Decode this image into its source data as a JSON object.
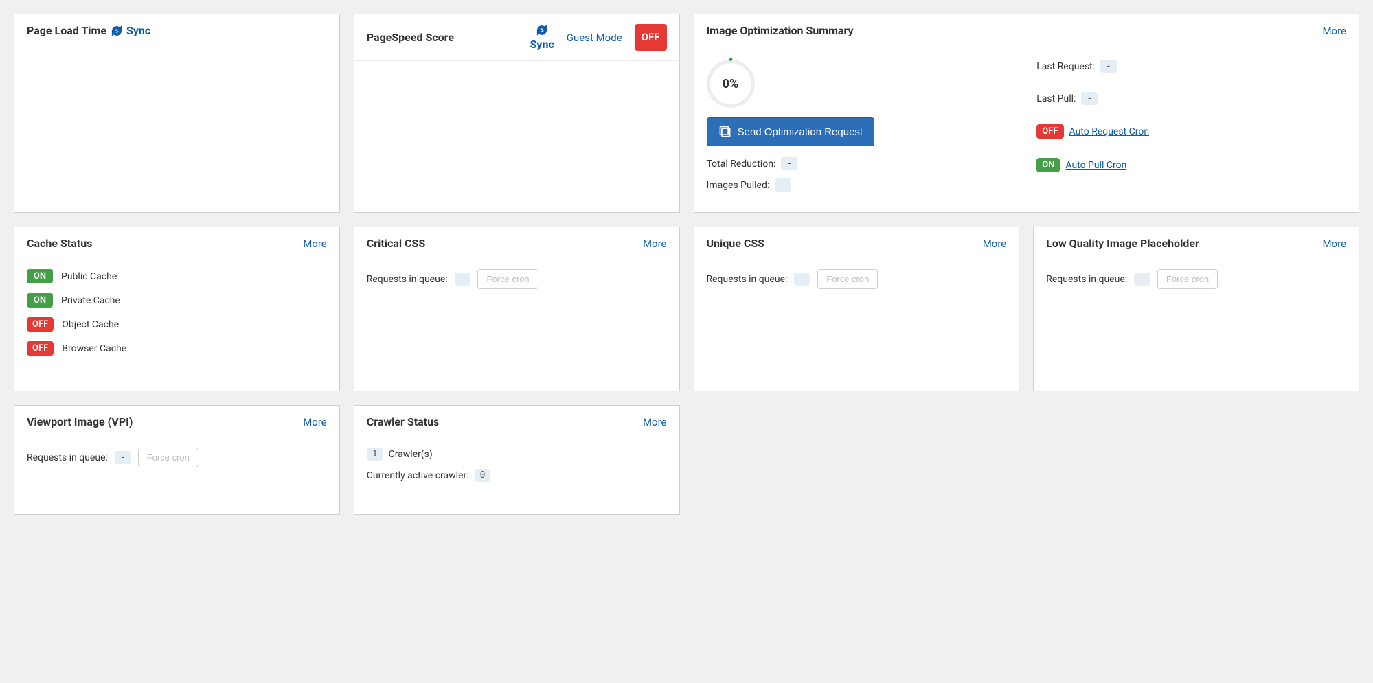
{
  "labels": {
    "sync": "Sync",
    "more": "More",
    "guest_mode": "Guest Mode",
    "force_cron": "Force cron",
    "requests_in_queue": "Requests in queue:",
    "on": "ON",
    "off": "OFF"
  },
  "page_load": {
    "title": "Page Load Time"
  },
  "pagespeed": {
    "title": "PageSpeed Score",
    "badge": "OFF"
  },
  "image_opt": {
    "title": "Image Optimization Summary",
    "gauge": "0%",
    "send_button": "Send Optimization Request",
    "total_reduction_label": "Total Reduction:",
    "total_reduction_value": "-",
    "images_pulled_label": "Images Pulled:",
    "images_pulled_value": "-",
    "last_request_label": "Last Request:",
    "last_request_value": "-",
    "last_pull_label": "Last Pull:",
    "last_pull_value": "-",
    "auto_request_cron": "Auto Request Cron",
    "auto_request_cron_state": "OFF",
    "auto_pull_cron": "Auto Pull Cron",
    "auto_pull_cron_state": "ON"
  },
  "cache_status": {
    "title": "Cache Status",
    "items": [
      {
        "state": "ON",
        "label": "Public Cache"
      },
      {
        "state": "ON",
        "label": "Private Cache"
      },
      {
        "state": "OFF",
        "label": "Object Cache"
      },
      {
        "state": "OFF",
        "label": "Browser Cache"
      }
    ]
  },
  "critical_css": {
    "title": "Critical CSS",
    "queue_value": "-"
  },
  "unique_css": {
    "title": "Unique CSS",
    "queue_value": "-"
  },
  "lqip": {
    "title": "Low Quality Image Placeholder",
    "queue_value": "-"
  },
  "vpi": {
    "title": "Viewport Image (VPI)",
    "queue_value": "-"
  },
  "crawler": {
    "title": "Crawler Status",
    "count": "1",
    "count_label": "Crawler(s)",
    "active_label": "Currently active crawler:",
    "active_value": "0"
  }
}
